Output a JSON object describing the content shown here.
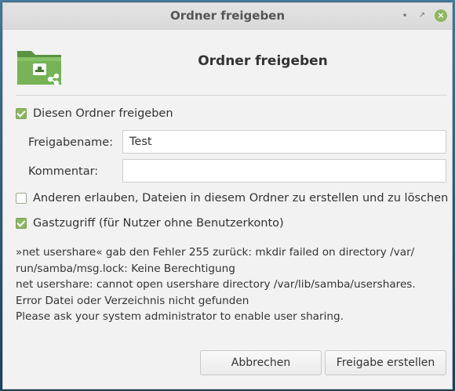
{
  "window": {
    "title": "Ordner freigeben",
    "controls": [
      "minimize-icon",
      "maximize-icon",
      "close-icon"
    ]
  },
  "dialog": {
    "heading": "Ordner freigeben",
    "icon": "shared-folder-icon",
    "share_checkbox": {
      "label": "Diesen Ordner freigeben",
      "checked": true
    },
    "share_name": {
      "label": "Freigabename:",
      "value": "Test"
    },
    "comment": {
      "label": "Kommentar:",
      "value": ""
    },
    "allow_others_checkbox": {
      "label": "Anderen erlauben, Dateien in diesem Ordner zu erstellen und zu löschen",
      "checked": false
    },
    "guest_checkbox": {
      "label": "Gastzugriff (für Nutzer ohne Benutzerkonto)",
      "checked": true
    },
    "error_lines": [
      "»net usershare« gab den Fehler 255 zurück: mkdir failed on directory /var/",
      "run/samba/msg.lock: Keine Berechtigung",
      "net usershare: cannot open usershare directory /var/lib/samba/usershares.",
      "Error Datei oder Verzeichnis nicht gefunden",
      "Please ask your system administrator to enable user sharing."
    ],
    "cancel_label": "Abbrechen",
    "create_label": "Freigabe erstellen"
  },
  "colors": {
    "accent": "#8fb75f",
    "folder": "#6aa84f",
    "window_bg": "#f2f2f2"
  }
}
